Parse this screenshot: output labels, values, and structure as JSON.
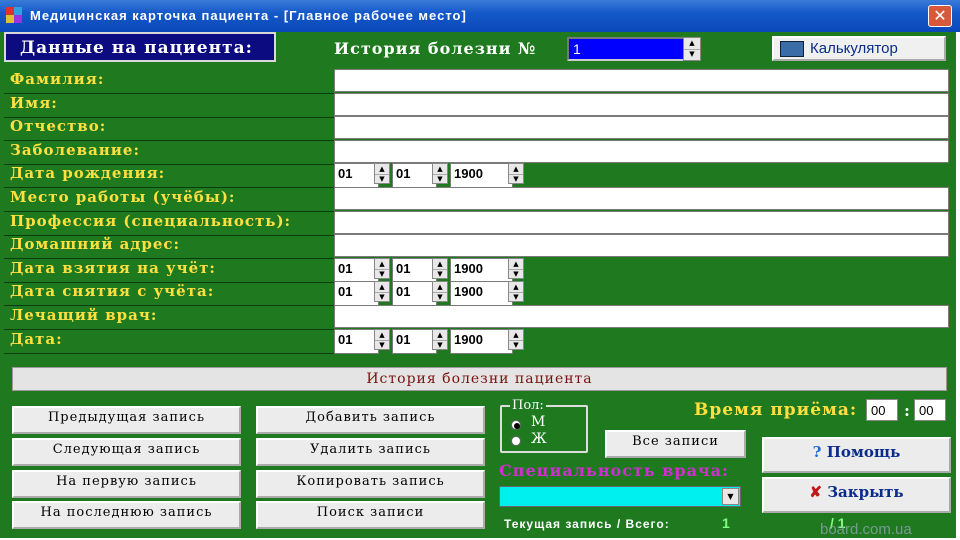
{
  "window": {
    "title": "Медицинская карточка пациента - [Главное рабочее место]"
  },
  "header": {
    "patient_data_label": "Данные на пациента:",
    "history_number_label": "История болезни №",
    "history_number_value": "1",
    "calculator_button": "Калькулятор"
  },
  "fields": [
    {
      "label": "Фамилия:",
      "type": "text"
    },
    {
      "label": "Имя:",
      "type": "text"
    },
    {
      "label": "Отчество:",
      "type": "text"
    },
    {
      "label": "Заболевание:",
      "type": "text"
    },
    {
      "label": "Дата рождения:",
      "type": "date",
      "day": "01",
      "month": "01",
      "year": "1900"
    },
    {
      "label": "Место работы (учёбы):",
      "type": "text"
    },
    {
      "label": "Профессия (специальность):",
      "type": "text"
    },
    {
      "label": "Домашний адрес:",
      "type": "text"
    },
    {
      "label": "Дата взятия на учёт:",
      "type": "date",
      "day": "01",
      "month": "01",
      "year": "1900"
    },
    {
      "label": "Дата снятия с учёта:",
      "type": "date",
      "day": "01",
      "month": "01",
      "year": "1900"
    },
    {
      "label": "Лечащий врач:",
      "type": "text"
    },
    {
      "label": "Дата:",
      "type": "date",
      "day": "01",
      "month": "01",
      "year": "1900"
    }
  ],
  "history_bar": "История болезни пациента",
  "nav_buttons": {
    "prev": "Предыдущая запись",
    "next": "Следующая запись",
    "first": "На первую запись",
    "last": "На последнюю запись",
    "add": "Добавить запись",
    "delete": "Удалить запись",
    "copy": "Копировать запись",
    "search": "Поиск записи",
    "all": "Все записи"
  },
  "gender": {
    "title": "Пол:",
    "male": "М",
    "female": "Ж",
    "selected": "М"
  },
  "visit_time": {
    "label": "Время приёма:",
    "hours": "00",
    "minutes": "00",
    "separator": ":"
  },
  "specialty": {
    "label": "Специальность врача:"
  },
  "counter": {
    "label": "Текущая запись / Всего:",
    "current": "1",
    "total": "/ 1"
  },
  "side_buttons": {
    "help": "Помощь",
    "close": "Закрыть"
  },
  "watermark": "board.com.ua",
  "colors": {
    "panel": "#1f7a1f",
    "label": "#ffe040",
    "specialty": "#d02ed0",
    "titlebar": "#1559c9"
  }
}
